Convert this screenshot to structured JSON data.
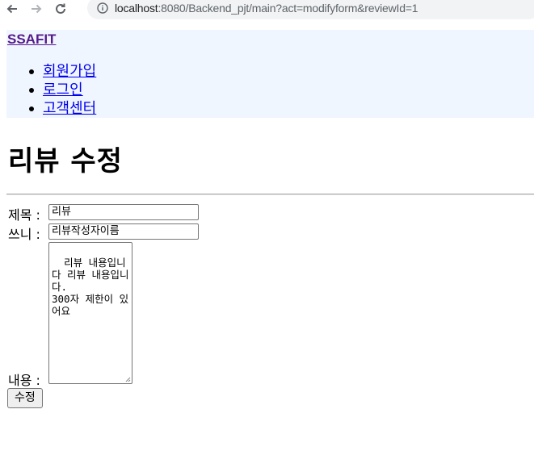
{
  "browser": {
    "url_host": "localhost",
    "url_rest": ":8080/Backend_pjt/main?act=modifyform&reviewId=1",
    "back_icon": "back-arrow-icon",
    "forward_icon": "forward-arrow-icon",
    "reload_icon": "reload-icon",
    "info_icon": "info-icon"
  },
  "header": {
    "brand": "SSAFIT",
    "menu": [
      {
        "label": "회원가입"
      },
      {
        "label": "로그인"
      },
      {
        "label": "고객센터"
      }
    ]
  },
  "page": {
    "title": "리뷰 수정"
  },
  "form": {
    "title_label": "제목 :",
    "title_value": "리뷰",
    "writer_label": "쓰니 :",
    "writer_value": "리뷰작성자이름",
    "content_label": "내용 :",
    "content_value": "리뷰 내용입니다 리뷰 내용입니다.\n300자 제한이 있어요",
    "submit_label": "수정"
  }
}
